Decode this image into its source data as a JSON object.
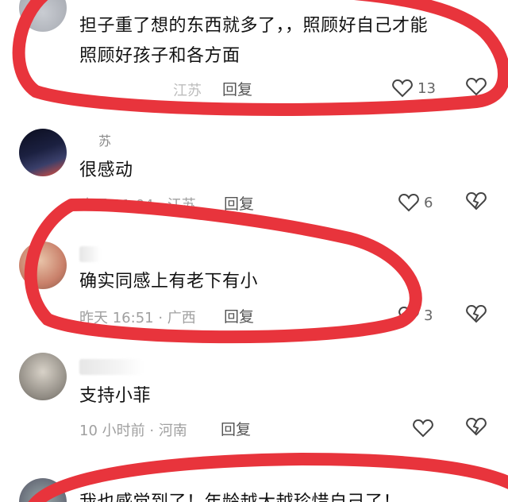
{
  "colors": {
    "annotation": "#e8343c",
    "meta": "#a0a0a0",
    "text": "#111111"
  },
  "comments": [
    {
      "text_line1": "担子重了想的东西就多了，，照顾好自己才能",
      "text_line2": "照顾好孩子和各方面",
      "time": "",
      "location": "江苏",
      "reply": "回复",
      "likes": "13"
    },
    {
      "username_partial": "苏",
      "text_line1": "很感动",
      "time": "昨天 11:04",
      "location": "江苏",
      "reply": "回复",
      "likes": "6"
    },
    {
      "text_line1": "确实同感上有老下有小",
      "time": "昨天 16:51",
      "location": "广西",
      "reply": "回复",
      "likes": "3"
    },
    {
      "text_line1": "支持小菲",
      "time": "10 小时前",
      "location": "河南",
      "reply": "回复",
      "likes": ""
    },
    {
      "text_line1": "我也感觉到了！年龄越大越珍惜自己了！"
    }
  ],
  "meta_sep": " · "
}
